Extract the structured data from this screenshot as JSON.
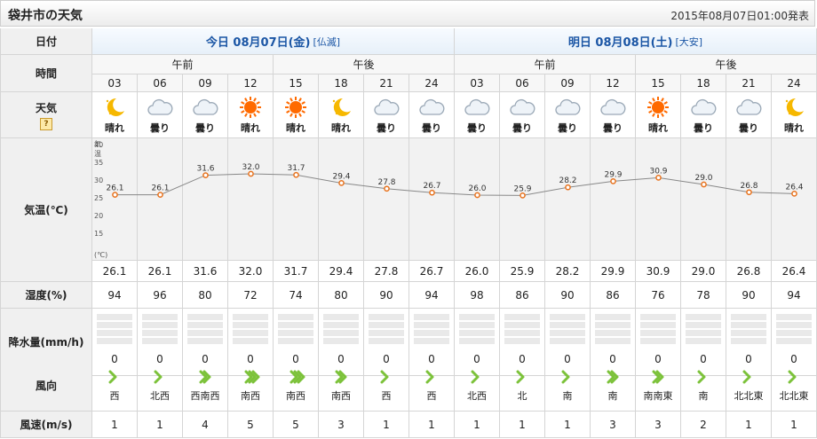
{
  "page": {
    "title": "袋井市の天気",
    "issued": "2015年08月07日01:00発表"
  },
  "labels": {
    "date": "日付",
    "time": "時間",
    "weather": "天気",
    "weather_help": "?",
    "temp": "気温(℃)",
    "humidity": "湿度(%)",
    "precip": "降水量(mm/h)",
    "wind_dir": "風向",
    "wind_speed": "風速(m/s)"
  },
  "days": [
    {
      "label": "今日 08月07日(金)",
      "rokuyo": "[仏滅]",
      "periods": [
        "午前",
        "午後"
      ]
    },
    {
      "label": "明日 08月08日(土)",
      "rokuyo": "[大安]",
      "periods": [
        "午前",
        "午後"
      ]
    }
  ],
  "hours": [
    "03",
    "06",
    "09",
    "12",
    "15",
    "18",
    "21",
    "24",
    "03",
    "06",
    "09",
    "12",
    "15",
    "18",
    "21",
    "24"
  ],
  "weather": [
    {
      "icon": "moon-icon",
      "text": "晴れ"
    },
    {
      "icon": "cloud-icon",
      "text": "曇り"
    },
    {
      "icon": "cloud-icon",
      "text": "曇り"
    },
    {
      "icon": "sun-icon",
      "text": "晴れ"
    },
    {
      "icon": "sun-icon",
      "text": "晴れ"
    },
    {
      "icon": "moon-icon",
      "text": "晴れ"
    },
    {
      "icon": "cloud-icon",
      "text": "曇り"
    },
    {
      "icon": "cloud-icon",
      "text": "曇り"
    },
    {
      "icon": "cloud-icon",
      "text": "曇り"
    },
    {
      "icon": "cloud-icon",
      "text": "曇り"
    },
    {
      "icon": "cloud-icon",
      "text": "曇り"
    },
    {
      "icon": "cloud-icon",
      "text": "曇り"
    },
    {
      "icon": "sun-icon",
      "text": "晴れ"
    },
    {
      "icon": "cloud-icon",
      "text": "曇り"
    },
    {
      "icon": "cloud-icon",
      "text": "曇り"
    },
    {
      "icon": "moon-icon",
      "text": "晴れ"
    }
  ],
  "chart_data": {
    "type": "line",
    "x": [
      "03",
      "06",
      "09",
      "12",
      "15",
      "18",
      "21",
      "24",
      "03",
      "06",
      "09",
      "12",
      "15",
      "18",
      "21",
      "24"
    ],
    "values": [
      26.1,
      26.1,
      31.6,
      32.0,
      31.7,
      29.4,
      27.8,
      26.7,
      26.0,
      25.9,
      28.2,
      29.9,
      30.9,
      29.0,
      26.8,
      26.4
    ],
    "labels": [
      "26.1",
      "26.1",
      "31.6",
      "32.0",
      "31.7",
      "29.4",
      "27.8",
      "26.7",
      "26.0",
      "25.9",
      "28.2",
      "29.9",
      "30.9",
      "29.0",
      "26.8",
      "26.4"
    ],
    "ylabel_top": "気温",
    "ylabel_bottom": "(℃)",
    "ylim": [
      10,
      40
    ],
    "yticks": [
      "40",
      "35",
      "30",
      "25",
      "20",
      "15"
    ]
  },
  "temps_text": [
    "26.1",
    "26.1",
    "31.6",
    "32.0",
    "31.7",
    "29.4",
    "27.8",
    "26.7",
    "26.0",
    "25.9",
    "28.2",
    "29.9",
    "30.9",
    "29.0",
    "26.8",
    "26.4"
  ],
  "humidity": [
    "94",
    "96",
    "80",
    "72",
    "74",
    "80",
    "90",
    "94",
    "98",
    "86",
    "90",
    "86",
    "76",
    "78",
    "90",
    "94"
  ],
  "precip": [
    "0",
    "0",
    "0",
    "0",
    "0",
    "0",
    "0",
    "0",
    "0",
    "0",
    "0",
    "0",
    "0",
    "0",
    "0",
    "0"
  ],
  "wind_dir": [
    {
      "text": "西",
      "strength": 1
    },
    {
      "text": "北西",
      "strength": 1
    },
    {
      "text": "西南西",
      "strength": 2
    },
    {
      "text": "南西",
      "strength": 3
    },
    {
      "text": "南西",
      "strength": 3
    },
    {
      "text": "南西",
      "strength": 2
    },
    {
      "text": "西",
      "strength": 1
    },
    {
      "text": "西",
      "strength": 1
    },
    {
      "text": "北西",
      "strength": 1
    },
    {
      "text": "北",
      "strength": 1
    },
    {
      "text": "南",
      "strength": 1
    },
    {
      "text": "南",
      "strength": 2
    },
    {
      "text": "南南東",
      "strength": 2
    },
    {
      "text": "南",
      "strength": 1
    },
    {
      "text": "北北東",
      "strength": 1
    },
    {
      "text": "北北東",
      "strength": 1
    }
  ],
  "wind_speed": [
    "1",
    "1",
    "4",
    "5",
    "5",
    "3",
    "1",
    "1",
    "1",
    "1",
    "1",
    "3",
    "3",
    "2",
    "1",
    "1"
  ],
  "colors": {
    "day_header_text": "#1b56a5",
    "temp_line": "#888888",
    "temp_point": "#e8731e",
    "wind_arrow": "#7cc23a",
    "sun": "#ff6a00",
    "moon": "#f6b800"
  }
}
